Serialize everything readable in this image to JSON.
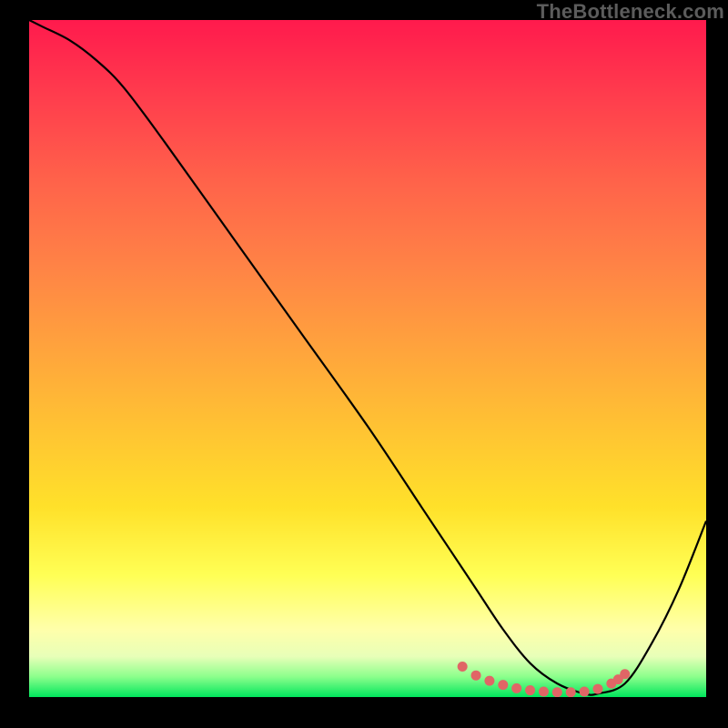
{
  "watermark": "TheBottleneck.com",
  "chart_data": {
    "type": "line",
    "title": "",
    "xlabel": "",
    "ylabel": "",
    "xlim": [
      0,
      100
    ],
    "ylim": [
      0,
      100
    ],
    "series": [
      {
        "name": "curve",
        "x": [
          0,
          2,
          6,
          10,
          14,
          20,
          30,
          40,
          50,
          58,
          62,
          66,
          70,
          74,
          78,
          82,
          84,
          88,
          92,
          96,
          100
        ],
        "y": [
          100,
          99,
          97,
          94,
          90,
          82,
          68,
          54,
          40,
          28,
          22,
          16,
          10,
          5,
          2,
          0.5,
          0.5,
          2,
          8,
          16,
          26
        ]
      }
    ],
    "markers": {
      "name": "valley-dots",
      "x": [
        64,
        66,
        68,
        70,
        72,
        74,
        76,
        78,
        80,
        82,
        84,
        86,
        87,
        88
      ],
      "y": [
        4.5,
        3.2,
        2.4,
        1.8,
        1.3,
        1.0,
        0.8,
        0.7,
        0.7,
        0.8,
        1.2,
        2.0,
        2.6,
        3.4
      ]
    },
    "grid": false,
    "legend": false,
    "notes": "Values are read off the plot in percent of axis span; x and y each span 0–100. Curve starts top-left, descends to a flat valley around x≈78–84, y≈0.5, then rises toward the right edge. Pink dots ride along the valley of the curve."
  }
}
